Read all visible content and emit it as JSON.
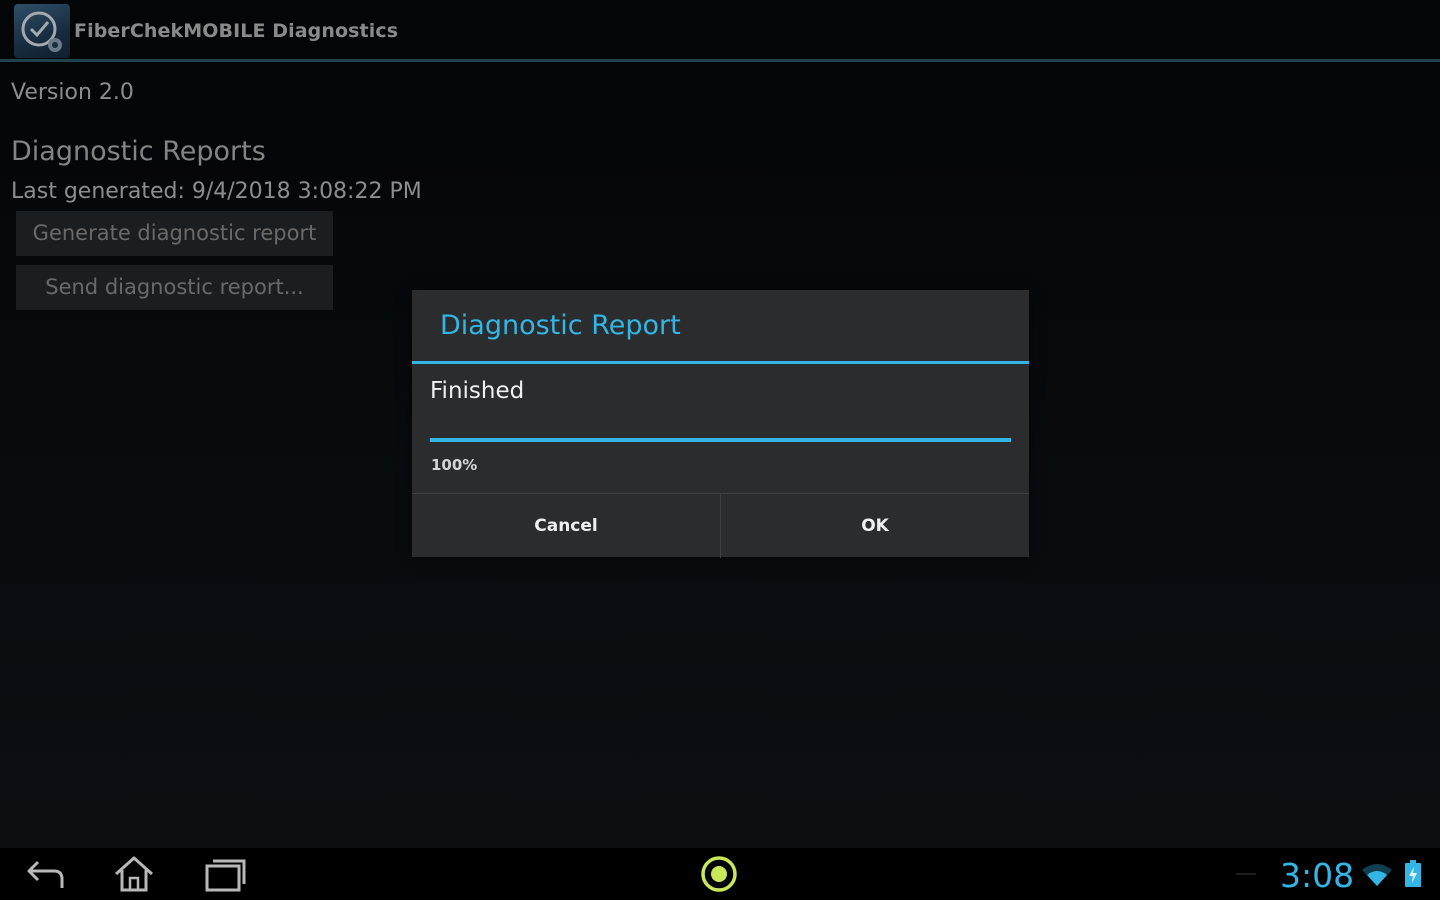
{
  "titlebar": {
    "app_title": "FiberChekMOBILE Diagnostics",
    "icon": "fiberchek-app-icon"
  },
  "main": {
    "version": "Version 2.0",
    "section_title": "Diagnostic Reports",
    "last_generated": "Last generated: 9/4/2018 3:08:22 PM",
    "generate_button": "Generate diagnostic report",
    "send_button": "Send diagnostic report..."
  },
  "dialog": {
    "title": "Diagnostic Report",
    "message": "Finished",
    "progress_percent_text": "100%",
    "progress_value": 1.0,
    "cancel_label": "Cancel",
    "ok_label": "OK"
  },
  "navbar": {
    "clock": "3:08",
    "icons": [
      "back-icon",
      "home-icon",
      "recent-apps-icon",
      "fiberchek-notification-icon",
      "wifi-icon",
      "battery-icon"
    ]
  },
  "colors": {
    "accent": "#33b5e5",
    "dialog_bg": "#2b2c2e",
    "button_bg": "#25282b"
  }
}
